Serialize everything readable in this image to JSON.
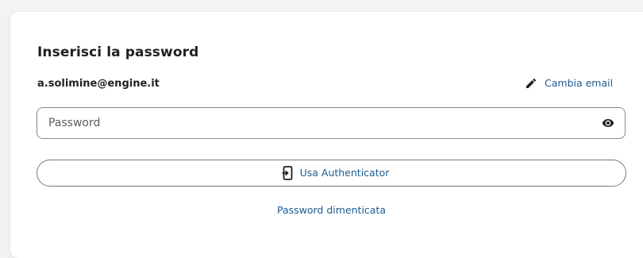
{
  "form": {
    "title": "Inserisci la password",
    "email": "a.solimine@engine.it",
    "change_email_label": "Cambia email",
    "password_placeholder": "Password",
    "password_value": "",
    "authenticator_label": "Usa Authenticator",
    "forgot_password_label": "Password dimenticata"
  },
  "icons": {
    "change_email": "pencil-icon",
    "password_toggle": "eye-icon",
    "authenticator": "phone-login-icon"
  },
  "colors": {
    "accent": "#1d5a91",
    "text": "#1f1f1f",
    "border": "#8a8a8a",
    "background": "#f3f3f4",
    "card": "#ffffff"
  }
}
